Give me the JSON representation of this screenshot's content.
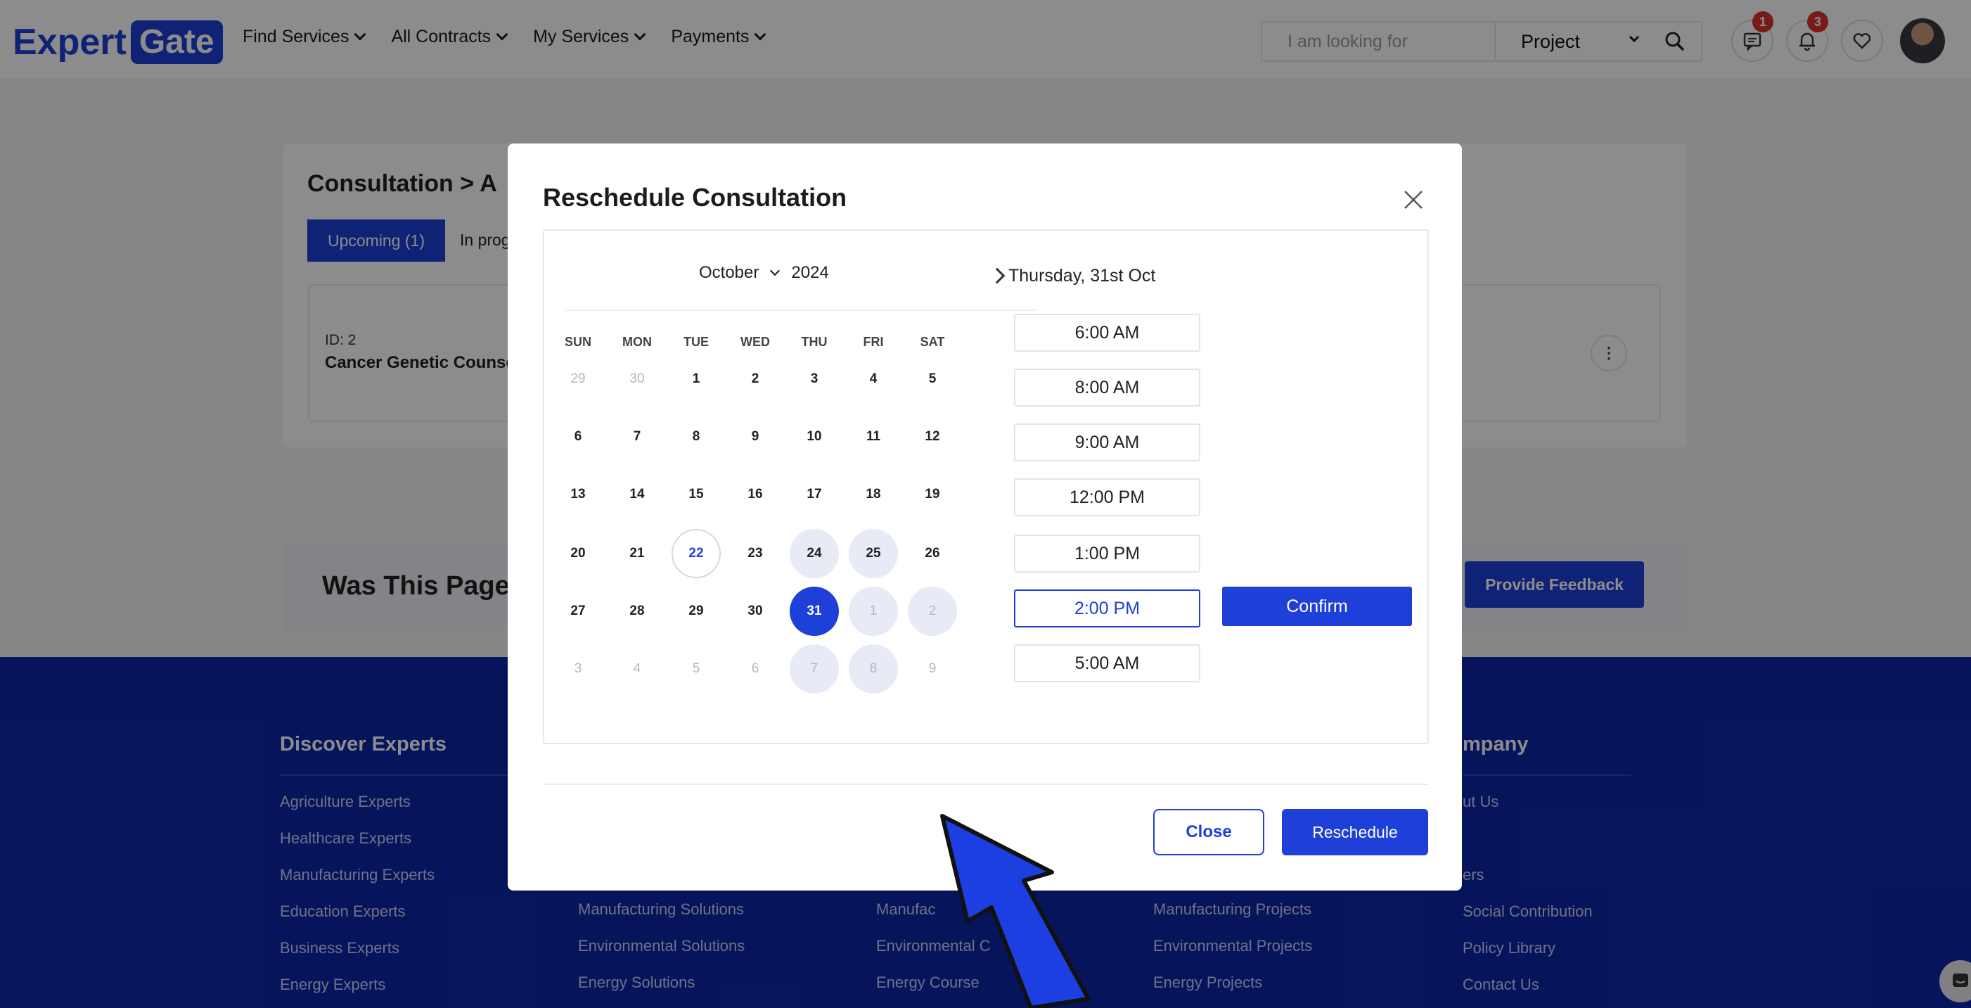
{
  "header": {
    "logo_left": "Expert",
    "logo_right": "Gate",
    "nav": [
      "Find Services",
      "All Contracts",
      "My Services",
      "Payments"
    ],
    "search_placeholder": "I am looking for",
    "search_type": "Project",
    "messages_count": "1",
    "notifications_count": "3"
  },
  "background_page": {
    "breadcrumb": "Consultation > A",
    "tabs": [
      "Upcoming (1)",
      "In prog"
    ],
    "item_id": "ID: 2",
    "item_name": "Cancer Genetic Counse",
    "feedback_question": "Was This Page U",
    "feedback_button": "Provide Feedback"
  },
  "footer": {
    "columns": [
      {
        "heading": "Discover Experts",
        "links": [
          "Agriculture Experts",
          "Healthcare Experts",
          "Manufacturing Experts",
          "Education Experts",
          "Business Experts",
          "Energy Experts"
        ]
      },
      {
        "heading": "",
        "links": [
          "Manufacturing Solutions",
          "Environmental Solutions",
          "Energy Solutions"
        ]
      },
      {
        "heading": "",
        "links": [
          "Manufac",
          "Environmental C",
          "Energy Course"
        ]
      },
      {
        "heading": "",
        "links": [
          "Manufacturing Projects",
          "Environmental Projects",
          "Energy Projects"
        ]
      },
      {
        "heading": "mpany",
        "links": [
          "ut Us",
          "",
          "ers",
          "Social Contribution",
          "Policy Library",
          "Contact Us"
        ]
      }
    ]
  },
  "modal": {
    "title": "Reschedule Consultation",
    "month": "October",
    "year": "2024",
    "weekdays": [
      "SUN",
      "MON",
      "TUE",
      "WED",
      "THU",
      "FRI",
      "SAT"
    ],
    "weeks": [
      [
        "29",
        "30",
        "1",
        "2",
        "3",
        "4",
        "5"
      ],
      [
        "6",
        "7",
        "8",
        "9",
        "10",
        "11",
        "12"
      ],
      [
        "13",
        "14",
        "15",
        "16",
        "17",
        "18",
        "19"
      ],
      [
        "20",
        "21",
        "22",
        "23",
        "24",
        "25",
        "26"
      ],
      [
        "27",
        "28",
        "29",
        "30",
        "31",
        "1",
        "2"
      ],
      [
        "3",
        "4",
        "5",
        "6",
        "7",
        "8",
        "9"
      ]
    ],
    "today": "22",
    "selected_day": "31",
    "selected_date_label": "Thursday, 31st Oct",
    "time_slots": [
      "6:00 AM",
      "8:00 AM",
      "9:00 AM",
      "12:00 PM",
      "1:00 PM",
      "2:00 PM",
      "5:00 AM"
    ],
    "selected_slot": "2:00 PM",
    "confirm_label": "Confirm",
    "close_label": "Close",
    "reschedule_label": "Reschedule"
  },
  "colors": {
    "brand": "#1e3fd8",
    "footer": "#0b26a8",
    "badge": "#d9302c",
    "annotation_arrow": "#1b3fe0"
  }
}
